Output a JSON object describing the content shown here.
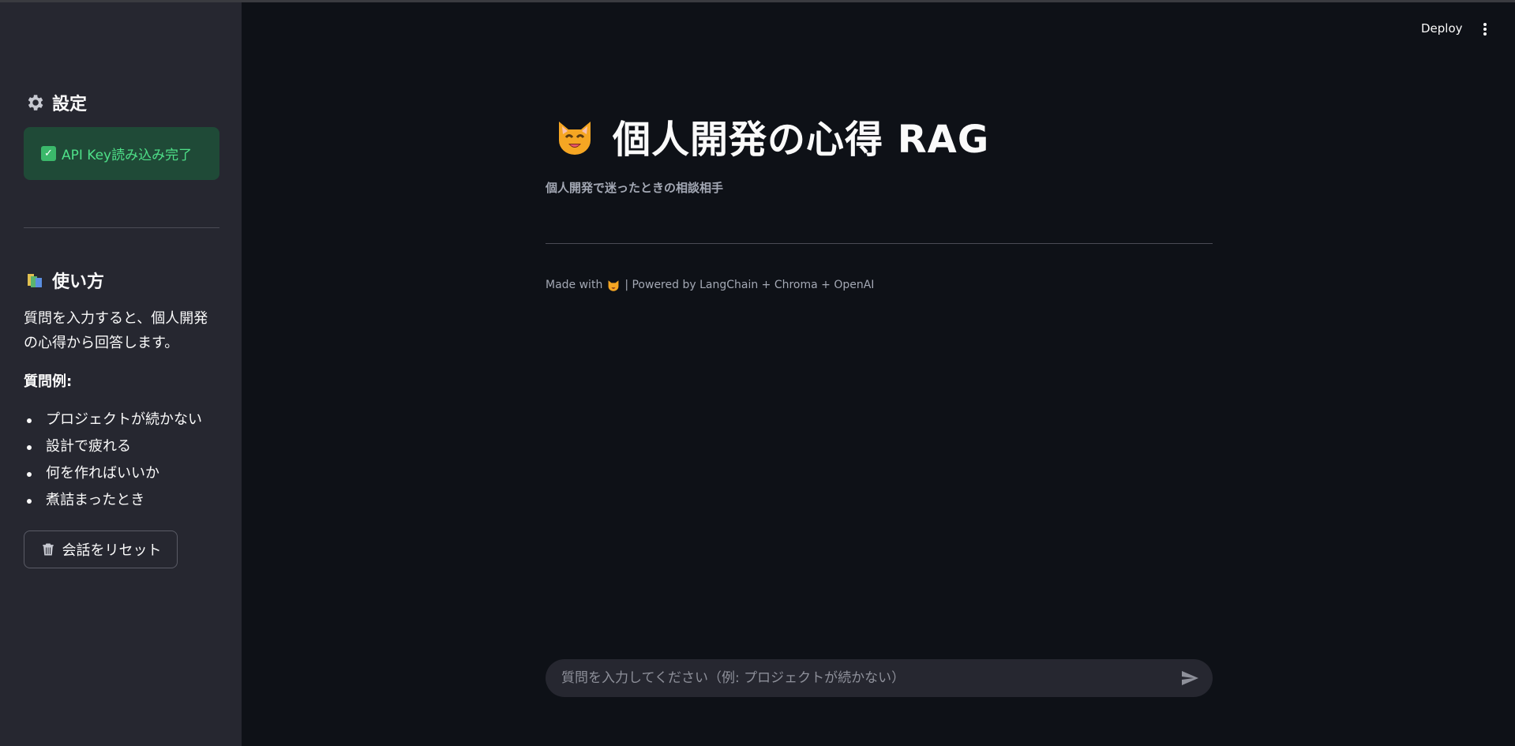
{
  "sidebar": {
    "settings_title": "設定",
    "api_status": "API Key読み込み完了",
    "usage_title": "使い方",
    "usage_desc": "質問を入力すると、個人開発の心得から回答します。",
    "examples_title": "質問例:",
    "examples": [
      "プロジェクトが続かない",
      "設計で疲れる",
      "何を作ればいいか",
      "煮詰まったとき"
    ],
    "reset_label": "会話をリセット"
  },
  "header": {
    "deploy_label": "Deploy"
  },
  "main": {
    "title": "個人開発の心得 RAG",
    "subtitle": "個人開発で迷ったときの相談相手",
    "footer_prefix": "Made with",
    "footer_suffix": "| Powered by LangChain + Chroma + OpenAI"
  },
  "chat": {
    "placeholder": "質問を入力してください（例: プロジェクトが続かない）",
    "value": ""
  },
  "icons": {
    "settings": "gear-icon",
    "status": "check-icon",
    "usage": "books-icon",
    "reset": "trash-icon",
    "title": "cat-icon",
    "send": "send-icon",
    "menu": "kebab-menu-icon"
  },
  "colors": {
    "background": "#0e1117",
    "sidebar": "#262730",
    "success_bg": "#1f4a37",
    "success_text": "#4ee088",
    "muted_text": "#a3a8b4"
  }
}
